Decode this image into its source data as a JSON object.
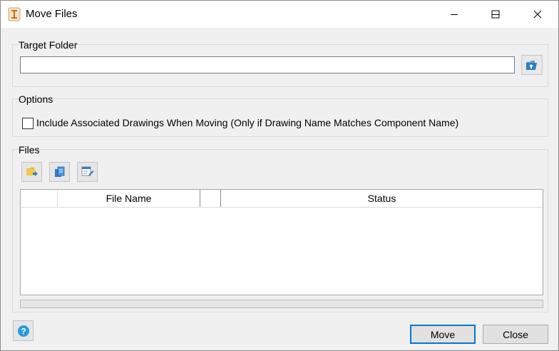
{
  "window": {
    "title": "Move Files"
  },
  "target_folder": {
    "label": "Target Folder",
    "value": "",
    "browse_icon": "open-folder-icon"
  },
  "options": {
    "label": "Options",
    "include_drawings": {
      "label": "Include Associated Drawings When Moving (Only if Drawing Name Matches Component Name)",
      "checked": false
    }
  },
  "files": {
    "label": "Files",
    "toolbar": [
      {
        "icon": "add-files-icon"
      },
      {
        "icon": "add-from-clipboard-icon"
      },
      {
        "icon": "edit-list-icon"
      }
    ],
    "columns": [
      "",
      "File Name",
      "",
      "Status"
    ],
    "rows": [],
    "progress": 0
  },
  "footer": {
    "help_icon": "help-icon",
    "move_label": "Move",
    "close_label": "Close"
  },
  "colors": {
    "accent": "#0078d7",
    "help_blue": "#2b9ad9"
  }
}
